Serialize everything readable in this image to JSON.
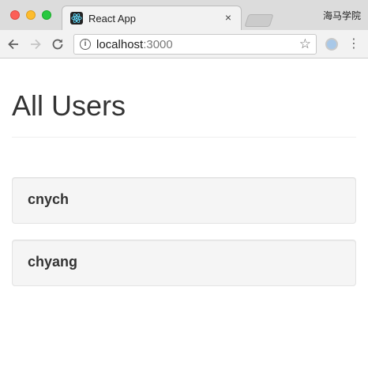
{
  "browser": {
    "tab_title": "React App",
    "tab_close": "×",
    "profile_name": "海马学院",
    "url_host": "localhost",
    "url_port": ":3000",
    "icons": {
      "back": "arrow-left-icon",
      "forward": "arrow-right-icon",
      "reload": "reload-icon",
      "info": "info-icon",
      "bookmark": "star-icon",
      "extension": "extension-icon",
      "menu": "kebab-menu-icon",
      "favicon": "react-logo-icon"
    }
  },
  "page": {
    "title": "All Users",
    "users": [
      {
        "name": "cnych"
      },
      {
        "name": "chyang"
      }
    ]
  },
  "colors": {
    "text": "#333333",
    "card_bg": "#f5f5f5",
    "card_border": "#e3e3e3",
    "react_blue": "#61dafb"
  }
}
